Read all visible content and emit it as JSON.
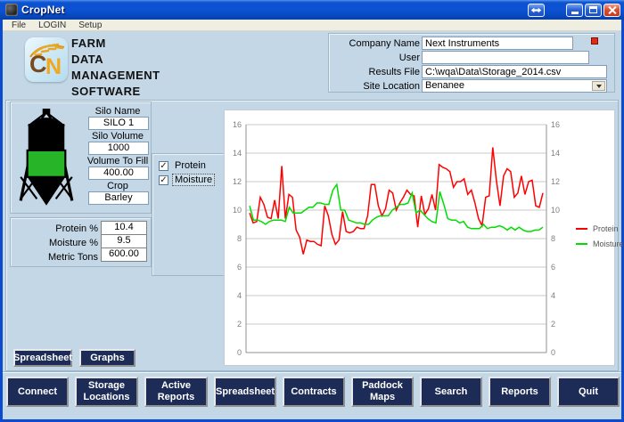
{
  "window": {
    "title": "CropNet"
  },
  "menu": {
    "items": [
      "File",
      "LOGIN",
      "Setup"
    ]
  },
  "header": {
    "logo_c": "C",
    "logo_n": "N",
    "title_lines": [
      "FARM",
      "DATA",
      "MANAGEMENT",
      "SOFTWARE"
    ]
  },
  "company_panel": {
    "company_name_label": "Company Name",
    "company_name_value": "Next Instruments",
    "user_label": "User",
    "user_value": "",
    "results_file_label": "Results File",
    "results_file_value": "C:\\wqa\\Data\\Storage_2014.csv",
    "site_location_label": "Site Location",
    "site_location_value": "Benanee"
  },
  "silo_panel": {
    "silo_name_label": "Silo Name",
    "silo_name_value": "SILO 1",
    "silo_volume_label": "Silo Volume",
    "silo_volume_value": "1000",
    "volume_to_fill_label": "Volume To Fill",
    "volume_to_fill_value": "400.00",
    "crop_label": "Crop",
    "crop_value": "Barley"
  },
  "readings_panel": {
    "protein_label": "Protein %",
    "protein_value": "10.4",
    "moisture_label": "Moisture %",
    "moisture_value": "9.5",
    "metric_tons_label": "Metric Tons",
    "metric_tons_value": "600.00"
  },
  "series_toggles": [
    {
      "label": "Protein",
      "checked": true
    },
    {
      "label": "Moisture",
      "checked": true
    }
  ],
  "side_buttons": {
    "spreadsheet": "Spreadsheet",
    "graphs": "Graphs"
  },
  "bottom_buttons": [
    "Connect",
    "Storage\nLocations",
    "Active Reports",
    "Spreadsheet",
    "Contracts",
    "Paddock Maps",
    "Search",
    "Reports",
    "Quit"
  ],
  "chart_data": {
    "type": "line",
    "title": "",
    "xlabel": "",
    "ylabel": "",
    "ylim": [
      0,
      16
    ],
    "yticks": [
      0,
      2,
      4,
      6,
      8,
      10,
      12,
      14,
      16
    ],
    "grid": true,
    "legend_position": "right",
    "series": [
      {
        "name": "Protein",
        "color": "#ff0000",
        "values": [
          9.8,
          9.1,
          9.2,
          10.9,
          10.4,
          9.5,
          9.4,
          10.7,
          9.4,
          13.1,
          9.4,
          11.1,
          10.9,
          8.6,
          8.1,
          6.9,
          7.9,
          7.8,
          7.8,
          7.6,
          7.5,
          10.3,
          9.6,
          8.3,
          7.6,
          7.9,
          9.9,
          8.5,
          8.4,
          8.5,
          8.8,
          8.7,
          8.7,
          9.6,
          11.8,
          11.8,
          10.3,
          9.6,
          10.1,
          11.4,
          11.2,
          10.0,
          10.5,
          10.9,
          11.4,
          11.1,
          11.0,
          8.8,
          11.0,
          9.7,
          10.1,
          11.1,
          10.0,
          13.2,
          13.0,
          12.9,
          12.7,
          11.6,
          12.0,
          12.0,
          12.2,
          11.1,
          11.4,
          10.5,
          9.4,
          8.9,
          10.9,
          11.0,
          14.4,
          12.1,
          10.3,
          12.4,
          12.9,
          12.7,
          10.9,
          11.2,
          12.4,
          11.1,
          12.0,
          12.1,
          10.3,
          10.2,
          11.2
        ]
      },
      {
        "name": "Moisture",
        "color": "#00dd00",
        "values": [
          10.3,
          9.3,
          9.3,
          9.2,
          9.0,
          9.2,
          9.3,
          9.3,
          9.3,
          9.2,
          10.2,
          9.8,
          9.8,
          9.8,
          10.0,
          10.2,
          10.2,
          10.5,
          10.5,
          10.4,
          10.4,
          11.4,
          11.8,
          10.0,
          10.0,
          9.3,
          9.2,
          9.1,
          9.1,
          9.0,
          9.0,
          9.3,
          9.5,
          9.6,
          9.6,
          9.6,
          10.0,
          10.2,
          10.4,
          10.4,
          10.5,
          11.2,
          9.8,
          10.0,
          9.7,
          9.4,
          9.2,
          9.1,
          11.3,
          10.4,
          9.4,
          9.3,
          9.3,
          9.1,
          9.2,
          8.8,
          8.7,
          8.7,
          8.7,
          9.0,
          8.7,
          8.8,
          8.8,
          8.9,
          8.8,
          8.6,
          8.8,
          8.6,
          8.8,
          8.6,
          8.5,
          8.5,
          8.6,
          8.6,
          8.8
        ]
      }
    ]
  }
}
